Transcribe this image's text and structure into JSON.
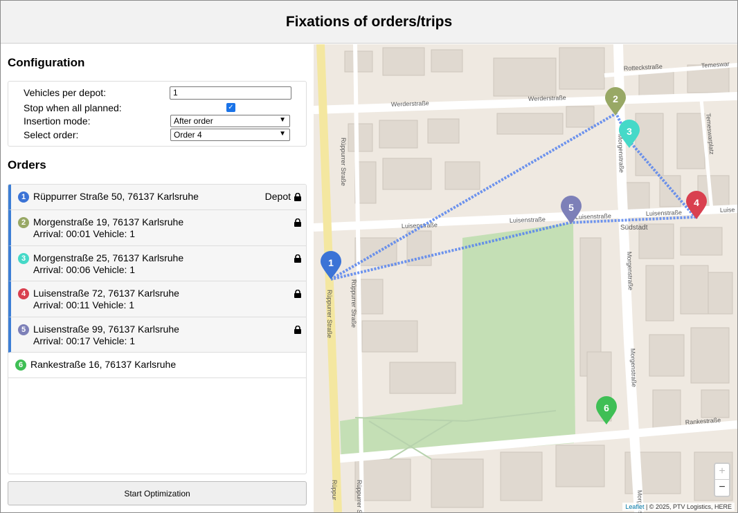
{
  "header": {
    "title": "Fixations of orders/trips"
  },
  "configuration": {
    "title": "Configuration",
    "vehicles_label": "Vehicles per depot:",
    "vehicles_value": "1",
    "stop_label": "Stop when all planned:",
    "stop_checked": true,
    "insertion_label": "Insertion mode:",
    "insertion_value": "After order",
    "select_label": "Select order:",
    "select_value": "Order 4"
  },
  "orders": {
    "title": "Orders",
    "items": [
      {
        "num": "1",
        "color": "#3b73d6",
        "address": "Rüppurrer Straße 50, 76137 Karlsruhe",
        "depot": "Depot",
        "locked": true,
        "fixed": true
      },
      {
        "num": "2",
        "color": "#98a865",
        "address": "Morgenstraße 19, 76137 Karlsruhe",
        "arrival": "Arrival: 00:01 Vehicle: 1",
        "locked": true,
        "fixed": true
      },
      {
        "num": "3",
        "color": "#45d9c8",
        "address": "Morgenstraße 25, 76137 Karlsruhe",
        "arrival": "Arrival: 00:06 Vehicle: 1",
        "locked": true,
        "fixed": true
      },
      {
        "num": "4",
        "color": "#d9404f",
        "address": "Luisenstraße 72, 76137 Karlsruhe",
        "arrival": "Arrival: 00:11 Vehicle: 1",
        "locked": true,
        "fixed": true
      },
      {
        "num": "5",
        "color": "#7d80b8",
        "address": "Luisenstraße 99, 76137 Karlsruhe",
        "arrival": "Arrival: 00:17 Vehicle: 1",
        "locked": true,
        "fixed": true
      },
      {
        "num": "6",
        "color": "#3fbf55",
        "address": "Rankestraße 16, 76137 Karlsruhe",
        "fixed": false
      }
    ]
  },
  "start_button": "Start Optimization",
  "map": {
    "streets": {
      "werder_1": "Werderstraße",
      "werder_2": "Werderstraße",
      "rotteck": "Rotteckstraße",
      "temeswar_1": "Temeswar",
      "temeswar_2": "Temeswarplatz",
      "ruppurrer_1": "Rüppurrer Straße",
      "ruppurrer_2": "Rüppurrer Straße",
      "ruppurrer_3": "Rüppurrer Straße",
      "ruppurrer_4": "Rüppur",
      "ruppurrer_5": "Rüppurrer Straße",
      "morgen_1": "Morgenstraße",
      "morgen_2": "Morgenstraße",
      "morgen_3": "Morgenstraße",
      "morgen_4": "Morgenstr",
      "luisen_1": "Luisenstraße",
      "luisen_2": "Luisenstraße",
      "luisen_3": "Luisenstraße",
      "luisen_4": "Luisenstraße",
      "luisen_5": "Luise",
      "suedstadt": "Südstadt",
      "ranke": "Rankestraße"
    },
    "markers": [
      "1",
      "2",
      "3",
      "4",
      "5",
      "6"
    ],
    "zoom_in": "+",
    "zoom_out": "−",
    "attribution_link": "Leaflet",
    "attribution_text": "| © 2025, PTV Logistics, HERE"
  }
}
